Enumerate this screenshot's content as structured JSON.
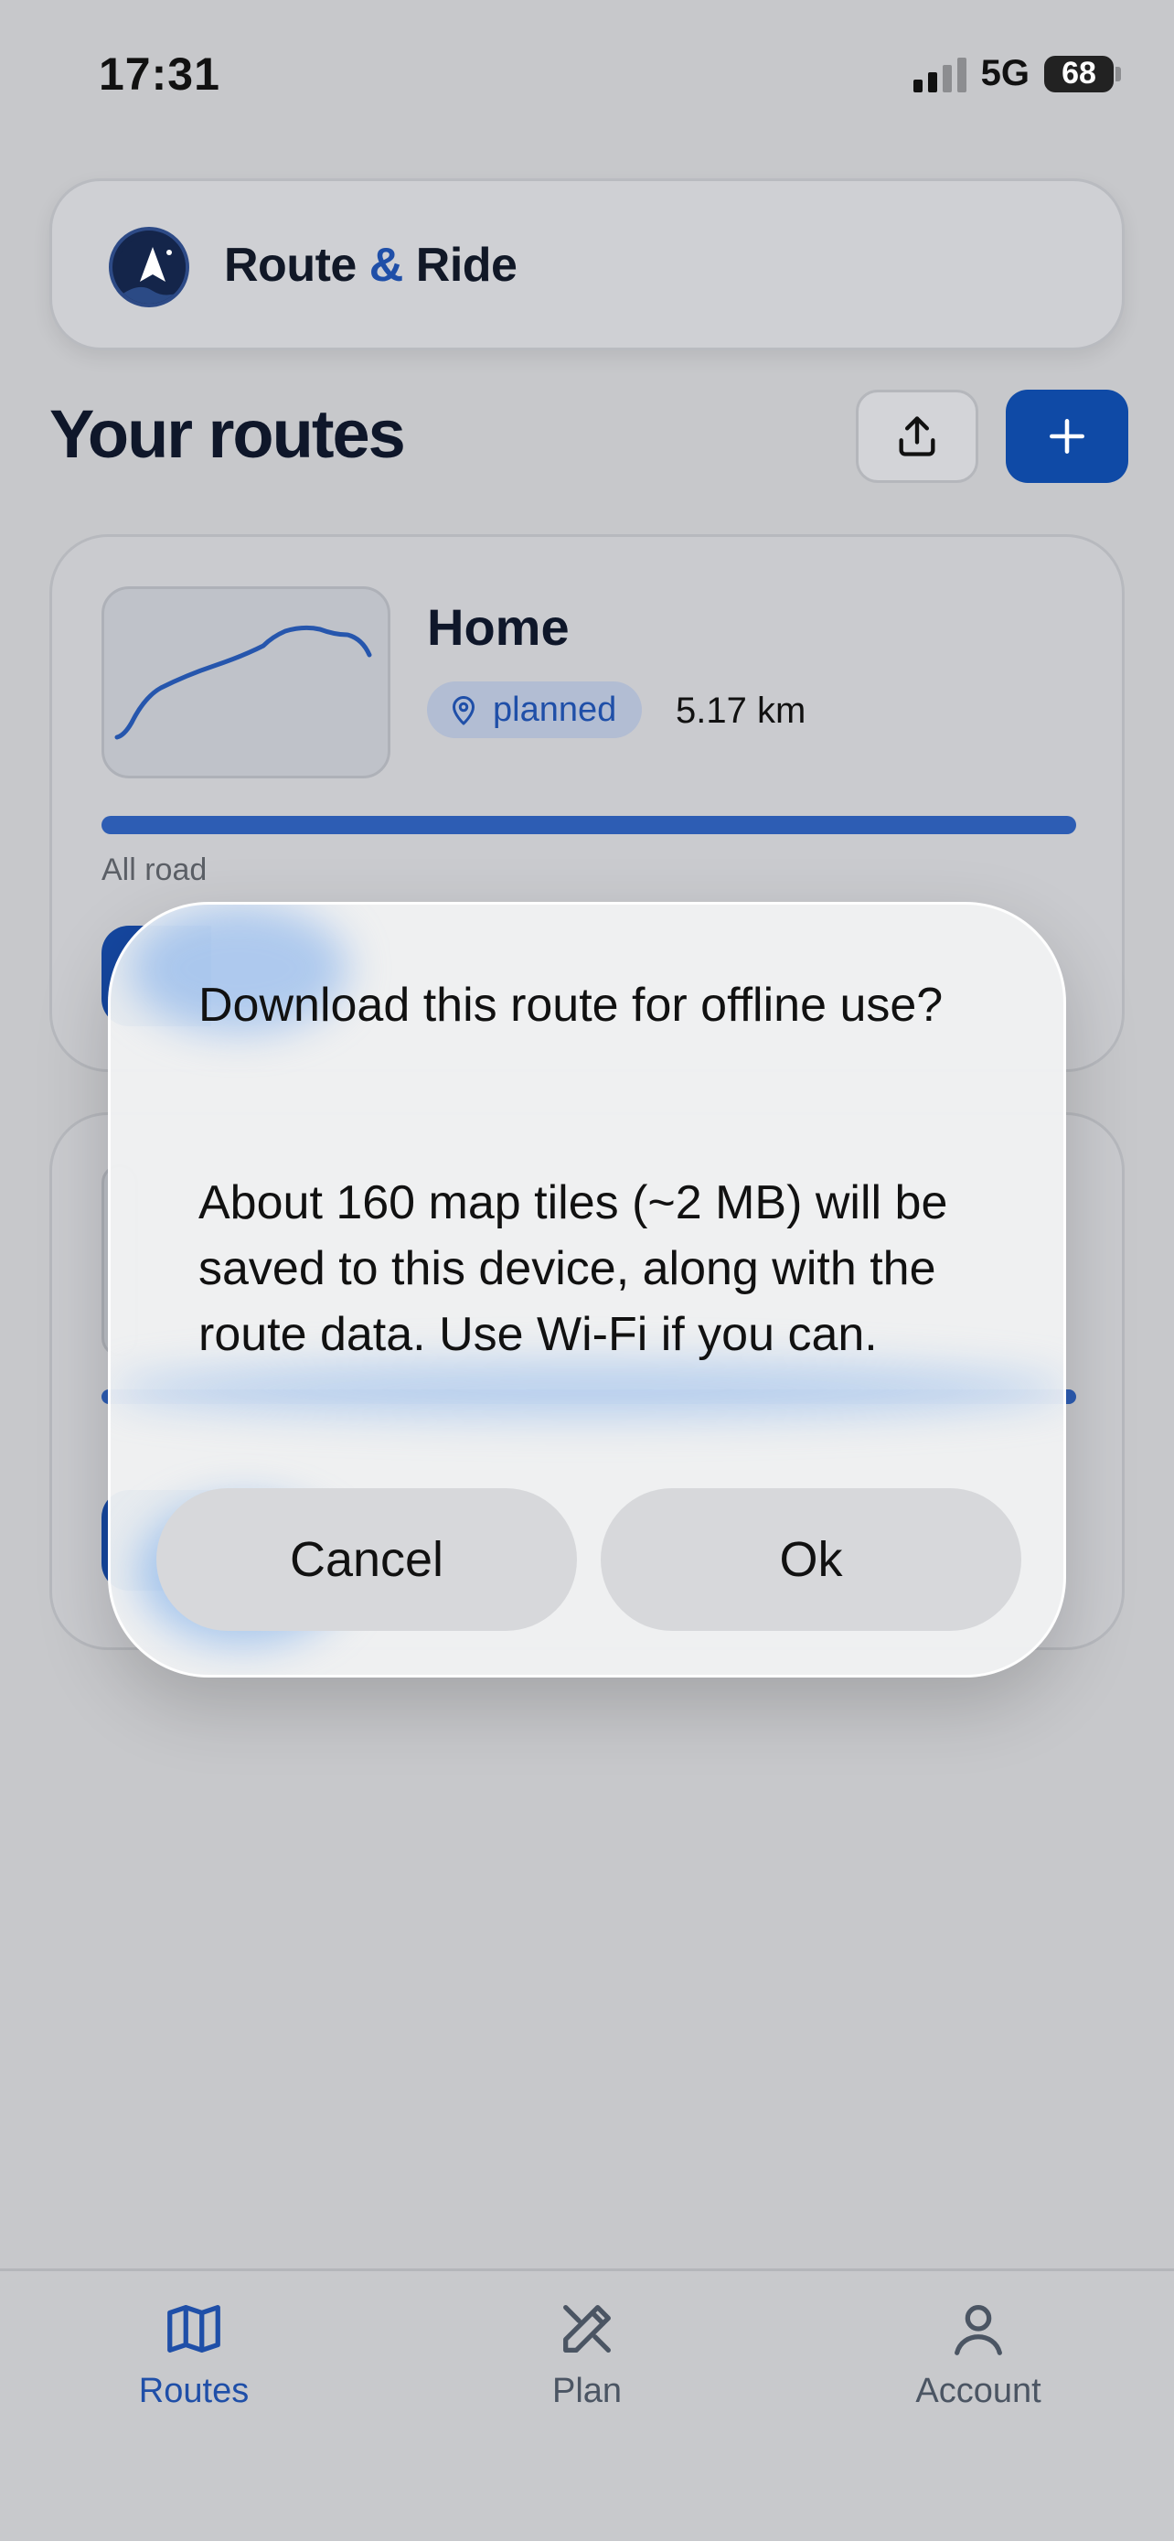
{
  "status_bar": {
    "time": "17:31",
    "network": "5G",
    "battery": "68"
  },
  "header": {
    "app_name_part1": "Route",
    "app_name_amp": "&",
    "app_name_part2": "Ride",
    "logo_icon": "mountain-logo-icon"
  },
  "section": {
    "title": "Your routes",
    "upload_icon": "upload-icon",
    "add_icon": "plus-icon"
  },
  "routes": [
    {
      "name": "Home",
      "status": "planned",
      "distance": "5.17 km",
      "surface": "All road",
      "progress": 1.0
    }
  ],
  "dialog": {
    "title": "Download this route for offline use?",
    "body": "About 160 map tiles (~2 MB) will be saved to this device, along with the route data. Use Wi-Fi if you can.",
    "cancel_label": "Cancel",
    "ok_label": "Ok"
  },
  "tab_bar": {
    "tabs": [
      {
        "label": "Routes",
        "icon": "map-icon",
        "active": true
      },
      {
        "label": "Plan",
        "icon": "ruler-pencil-icon",
        "active": false
      },
      {
        "label": "Account",
        "icon": "user-icon",
        "active": false
      }
    ]
  },
  "colors": {
    "accent": "#1f4fa8",
    "accent_dark": "#0f4aa6",
    "background": "#c7c8cb"
  }
}
